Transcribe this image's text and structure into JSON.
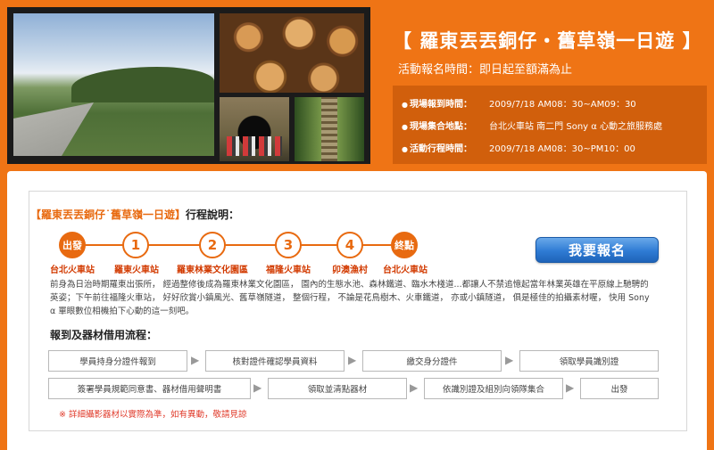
{
  "banner": {
    "title": "【 羅東丟丟銅仔・舊草嶺一日遊 】",
    "registration_time": "活動報名時間：即日起至額滿為止",
    "info": [
      {
        "label": "現場報到時間：",
        "value": "2009/7/18 AM08：30~AM09：30"
      },
      {
        "label": "現場集合地點：",
        "value": "台北火車站 南二門 Sony α 心動之旅服務處"
      },
      {
        "label": "活動行程時間：",
        "value": "2009/7/18 AM08：30~PM10：00"
      }
    ],
    "bullet": "●",
    "photos": [
      "railway-path-photo",
      "stacked-logs-photo",
      "tunnel-cyclists-photo",
      "forest-rail-photo"
    ]
  },
  "itinerary": {
    "title_highlight": "【羅東丟丟銅仔˙舊草嶺一日遊】",
    "title_suffix": "行程說明：",
    "steps": [
      {
        "badge": "出發",
        "label": "台北火車站",
        "filled": true
      },
      {
        "badge": "1",
        "label": "羅東火車站",
        "filled": false
      },
      {
        "badge": "2",
        "label": "羅東林業文化園區",
        "filled": false
      },
      {
        "badge": "3",
        "label": "福隆火車站",
        "filled": false
      },
      {
        "badge": "4",
        "label": "卯澳漁村",
        "filled": false
      },
      {
        "badge": "終點",
        "label": "台北火車站",
        "filled": true
      }
    ],
    "signup_label": "我要報名",
    "description": "前身為日治時期羅東出張所， 經過整修後成為羅東林業文化園區， 園內的生態水池、森林鐵道、臨水木棧道...都讓人不禁追憶起當年林業英雄在平原線上馳騁的英姿；下午前往福隆火車站， 好好欣賞小鎮風光、舊草嶺隧道， 整個行程， 不論是花鳥樹木、火車鐵道， 亦或小鎮隧道， 俱是極佳的拍攝素材喔， 快用 Sony α 單眼數位相機拍下心動的這一刻吧。"
  },
  "process": {
    "title": "報到及器材借用流程：",
    "row1": [
      "學員持身分證件報到",
      "核對證件確認學員資料",
      "繳交身分證件",
      "領取學員識別證"
    ],
    "row2": [
      "簽署學員規範同意書、器材借用聲明書",
      "領取並清點器材",
      "依識別證及組別向領隊集合",
      "出發"
    ],
    "arrow": "▶",
    "note": "※ 詳細攝影器材以實際為準，如有異動，敬請見諒"
  },
  "colors": {
    "accent": "#e86a10",
    "background": "#ef7415",
    "button": "#2f7bd4",
    "note": "#e03a2a"
  }
}
